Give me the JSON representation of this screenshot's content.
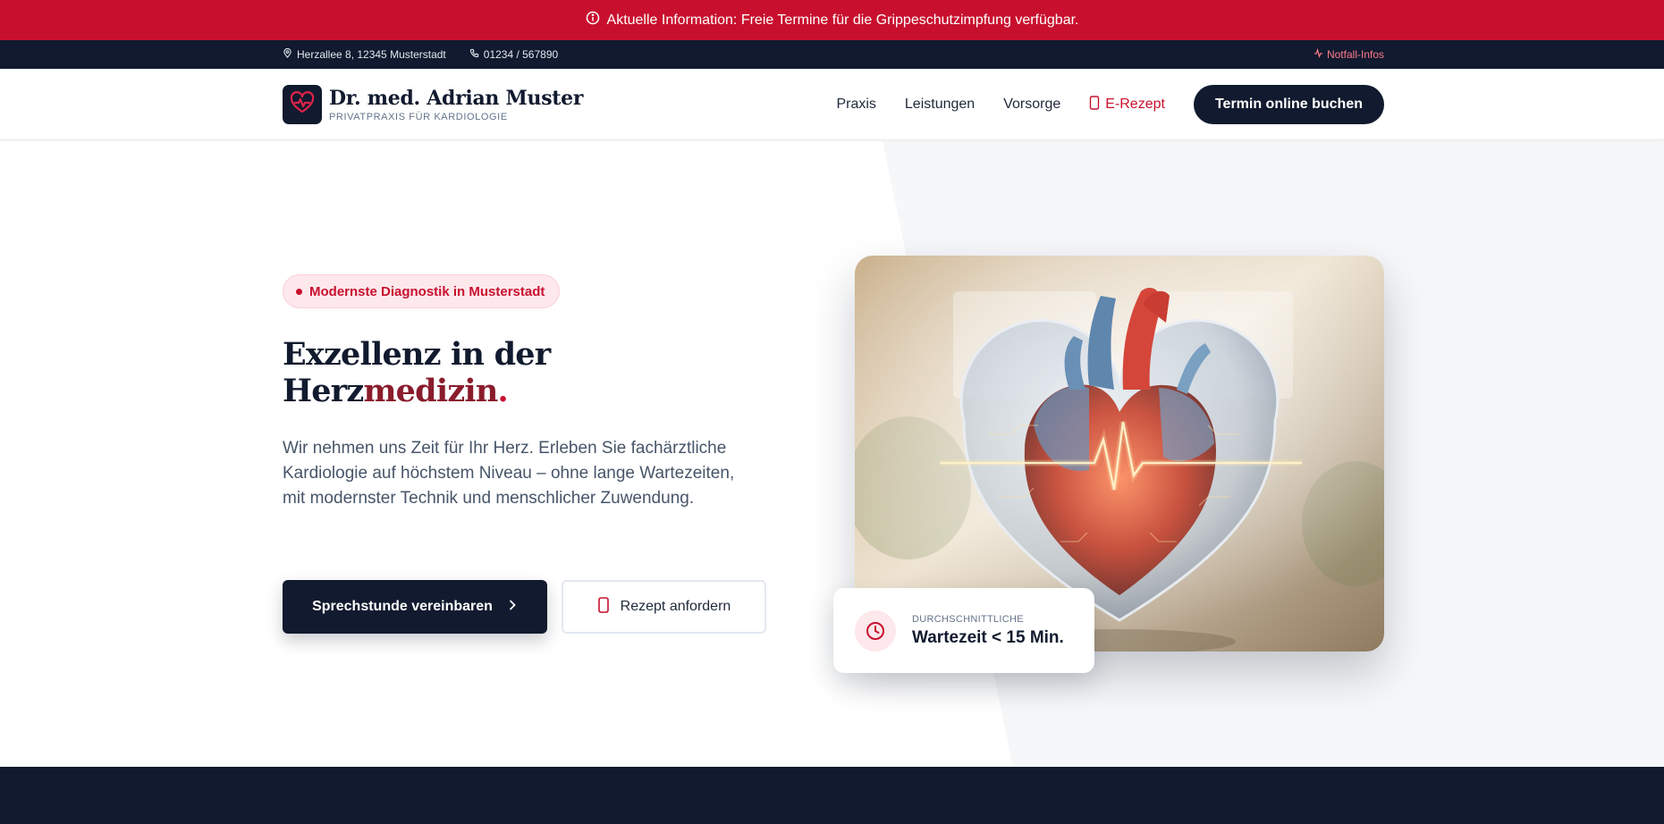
{
  "announcement": {
    "text": "Aktuelle Information: Freie Termine für die Grippeschutzimpfung verfügbar.",
    "icon": "info-circle-icon"
  },
  "topbar": {
    "address": "Herzallee 8, 12345 Musterstadt",
    "phone": "01234 / 567890",
    "emergency_link": "Notfall-Infos"
  },
  "brand": {
    "name": "Dr. med. Adrian Muster",
    "subtitle": "PRIVATPRAXIS FÜR KARDIOLOGIE",
    "icon": "heart-pulse-icon"
  },
  "nav": {
    "items": [
      {
        "label": "Praxis"
      },
      {
        "label": "Leistungen"
      },
      {
        "label": "Vorsorge"
      }
    ],
    "erezept_label": "E-Rezept",
    "cta_label": "Termin online buchen"
  },
  "hero": {
    "badge": "Modernste Diagnostik in Musterstadt",
    "headline_line1": "Exzellenz in der",
    "headline_line2_start": "Herz",
    "headline_line2_accent": "medizin",
    "headline_dot": ".",
    "lead": "Wir nehmen uns Zeit für Ihr Herz. Erleben Sie fachärztliche Kardiologie auf höchstem Niveau – ohne lange Wartezeiten, mit modernster Technik und menschlicher Zuwendung.",
    "primary_button": "Sprechstunde vereinbaren",
    "secondary_button": "Rezept anfordern"
  },
  "wait_card": {
    "label": "DURCHSCHNITTLICHE",
    "value": "Wartezeit < 15 Min.",
    "icon": "clock-icon"
  },
  "colors": {
    "brand_red": "#c8102e",
    "navy": "#111a2e",
    "text_muted": "#475569"
  }
}
